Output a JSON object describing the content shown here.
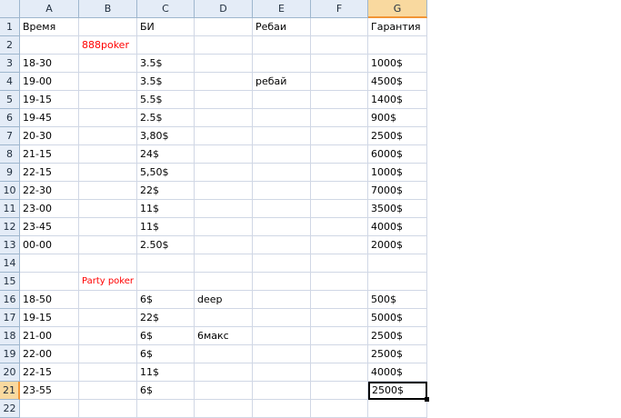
{
  "columns": [
    "A",
    "B",
    "C",
    "D",
    "E",
    "F",
    "G"
  ],
  "rows": [
    "1",
    "2",
    "3",
    "4",
    "5",
    "6",
    "7",
    "8",
    "9",
    "10",
    "11",
    "12",
    "13",
    "14",
    "15",
    "16",
    "17",
    "18",
    "19",
    "20",
    "21",
    "22"
  ],
  "cells": {
    "A1": "Время",
    "C1": "БИ",
    "E1": "Ребаи",
    "G1": "Гарантия",
    "B2": "888poker",
    "A3": "18-30",
    "C3": "3.5$",
    "G3": "1000$",
    "A4": "19-00",
    "C4": "3.5$",
    "E4": "ребай",
    "G4": "4500$",
    "A5": "19-15",
    "C5": "5.5$",
    "G5": "1400$",
    "A6": "19-45",
    "C6": "2.5$",
    "G6": "900$",
    "A7": "20-30",
    "C7": "3,80$",
    "G7": "2500$",
    "A8": "21-15",
    "C8": "24$",
    "G8": "6000$",
    "A9": "22-15",
    "C9": "5,50$",
    "G9": "1000$",
    "A10": "22-30",
    "C10": "22$",
    "G10": "7000$",
    "A11": "23-00",
    "C11": "11$",
    "G11": "3500$",
    "A12": "23-45",
    "C12": "11$",
    "G12": "4000$",
    "A13": "00-00",
    "C13": "2.50$",
    "G13": "2000$",
    "B15": "Party poker",
    "A16": "18-50",
    "C16": "6$",
    "D16": "deep",
    "G16": "500$",
    "C17": "22$",
    "G17": "5000$",
    "A17": "19-15",
    "A18": "21-00",
    "C18": "6$",
    "D18": "6макс",
    "G18": "2500$",
    "A19": "22-00",
    "C19": "6$",
    "G19": "2500$",
    "A20": "22-15",
    "C20": "11$",
    "G20": "4000$",
    "A21": "23-55",
    "C21": "6$",
    "G21": "2500$"
  },
  "red_cells": [
    "B2",
    "B15"
  ],
  "small_cells": [
    "B15"
  ],
  "active_cell": "G21",
  "colors": {
    "header_bg": "#e4ecf7",
    "header_selected": "#f9d99f",
    "grid": "#d0d7e5",
    "red_text": "#ff0000"
  }
}
